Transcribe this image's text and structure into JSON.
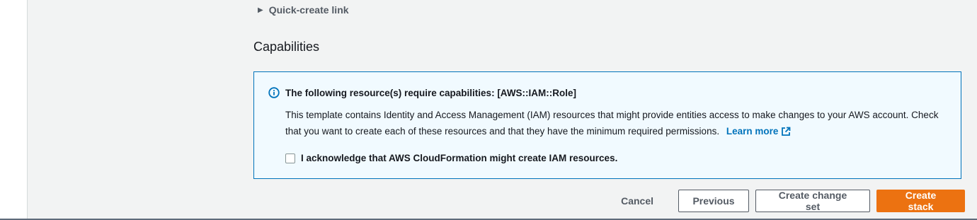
{
  "quick_create": {
    "label": "Quick-create link"
  },
  "capabilities": {
    "title": "Capabilities",
    "alert_title": "The following resource(s) require capabilities: [AWS::IAM::Role]",
    "alert_body": "This template contains Identity and Access Management (IAM) resources that might provide entities access to make changes to your AWS account. Check that you want to create each of these resources and that they have the minimum required permissions.",
    "learn_more": "Learn more",
    "acknowledge_label": "I acknowledge that AWS CloudFormation might create IAM resources.",
    "acknowledge_checked": false
  },
  "footer": {
    "cancel": "Cancel",
    "previous": "Previous",
    "create_change_set": "Create change set",
    "create_stack": "Create stack"
  },
  "colors": {
    "primary_button": "#ec7211",
    "link": "#0073bb",
    "info_background": "#f1faff",
    "info_border": "#0073bb"
  },
  "icons": {
    "caret": "caret-right-icon",
    "info": "info-icon",
    "external": "external-link-icon"
  }
}
